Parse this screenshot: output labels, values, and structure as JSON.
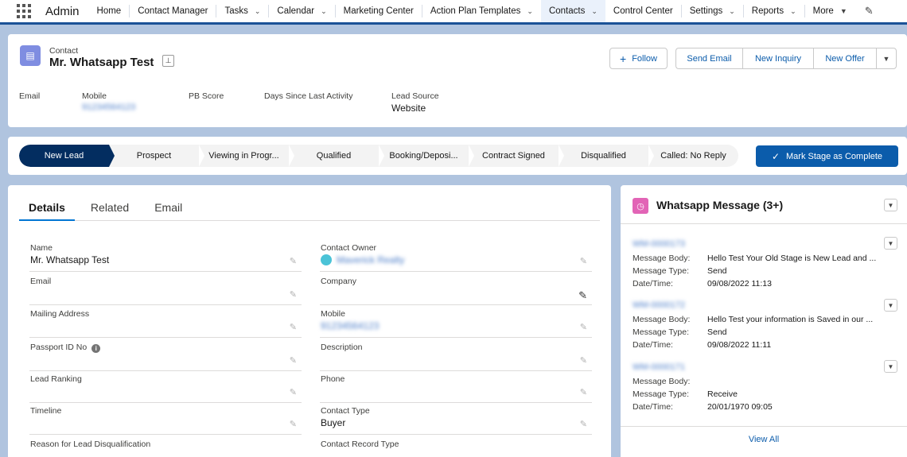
{
  "nav": {
    "app_name": "Admin",
    "items": [
      {
        "label": "Home",
        "has_menu": false
      },
      {
        "label": "Contact Manager",
        "has_menu": false
      },
      {
        "label": "Tasks",
        "has_menu": true
      },
      {
        "label": "Calendar",
        "has_menu": true
      },
      {
        "label": "Marketing Center",
        "has_menu": false
      },
      {
        "label": "Action Plan Templates",
        "has_menu": true
      },
      {
        "label": "Contacts",
        "has_menu": true,
        "active": true
      },
      {
        "label": "Control Center",
        "has_menu": false
      },
      {
        "label": "Settings",
        "has_menu": true
      },
      {
        "label": "Reports",
        "has_menu": true
      },
      {
        "label": "More",
        "has_menu": true
      }
    ]
  },
  "header": {
    "object_label": "Contact",
    "record_name": "Mr. Whatsapp Test",
    "actions": {
      "follow": "Follow",
      "send_email": "Send Email",
      "new_inquiry": "New Inquiry",
      "new_offer": "New Offer"
    },
    "highlights": [
      {
        "label": "Email",
        "value": ""
      },
      {
        "label": "Mobile",
        "value": "91234564123"
      },
      {
        "label": "PB Score",
        "value": ""
      },
      {
        "label": "Days Since Last Activity",
        "value": ""
      },
      {
        "label": "Lead Source",
        "value": "Website"
      }
    ]
  },
  "path": {
    "stages": [
      "New Lead",
      "Prospect",
      "Viewing in Progr...",
      "Qualified",
      "Booking/Deposi...",
      "Contract Signed",
      "Disqualified",
      "Called: No Reply"
    ],
    "current_index": 0,
    "mark_button": "Mark Stage as Complete"
  },
  "details": {
    "tabs": [
      "Details",
      "Related",
      "Email"
    ],
    "active_tab": "Details",
    "left_fields": [
      {
        "label": "Name",
        "value": "Mr. Whatsapp Test"
      },
      {
        "label": "Email",
        "value": ""
      },
      {
        "label": "Mailing Address",
        "value": ""
      },
      {
        "label": "Passport ID No",
        "value": "",
        "info": true
      },
      {
        "label": "Lead Ranking",
        "value": ""
      },
      {
        "label": "Timeline",
        "value": ""
      },
      {
        "label": "Reason for Lead Disqualification",
        "value": ""
      }
    ],
    "right_fields": [
      {
        "label": "Contact Owner",
        "value": "Maverick Realty"
      },
      {
        "label": "Company",
        "value": ""
      },
      {
        "label": "Mobile",
        "value": "91234564123"
      },
      {
        "label": "Description",
        "value": ""
      },
      {
        "label": "Phone",
        "value": ""
      },
      {
        "label": "Contact Type",
        "value": "Buyer"
      },
      {
        "label": "Contact Record Type",
        "value": ""
      }
    ]
  },
  "whatsapp": {
    "title": "Whatsapp Message (3+)",
    "keys": {
      "body": "Message Body:",
      "type": "Message Type:",
      "datetime": "Date/Time:"
    },
    "messages": [
      {
        "name": "WM-0000173",
        "body": "Hello Test Your Old Stage is New Lead and ...",
        "type": "Send",
        "datetime": "09/08/2022 11:13"
      },
      {
        "name": "WM-0000172",
        "body": "Hello Test your information is Saved in our ...",
        "type": "Send",
        "datetime": "09/08/2022 11:11"
      },
      {
        "name": "WM-0000171",
        "body": "",
        "type": "Receive",
        "datetime": "20/01/1970 09:05"
      }
    ],
    "view_all": "View All"
  },
  "colors": {
    "brand": "#0b5cab",
    "nav_accent": "#1b5297",
    "path_current": "#032d60",
    "contact_icon": "#7f8de1",
    "whatsapp_icon": "#e264b6",
    "background": "#b0c4df"
  },
  "icons": {
    "app_launcher": "waffle-icon",
    "contact": "contact-card-icon",
    "whatsapp": "whatsapp-message-icon",
    "edit": "pencil-icon"
  }
}
